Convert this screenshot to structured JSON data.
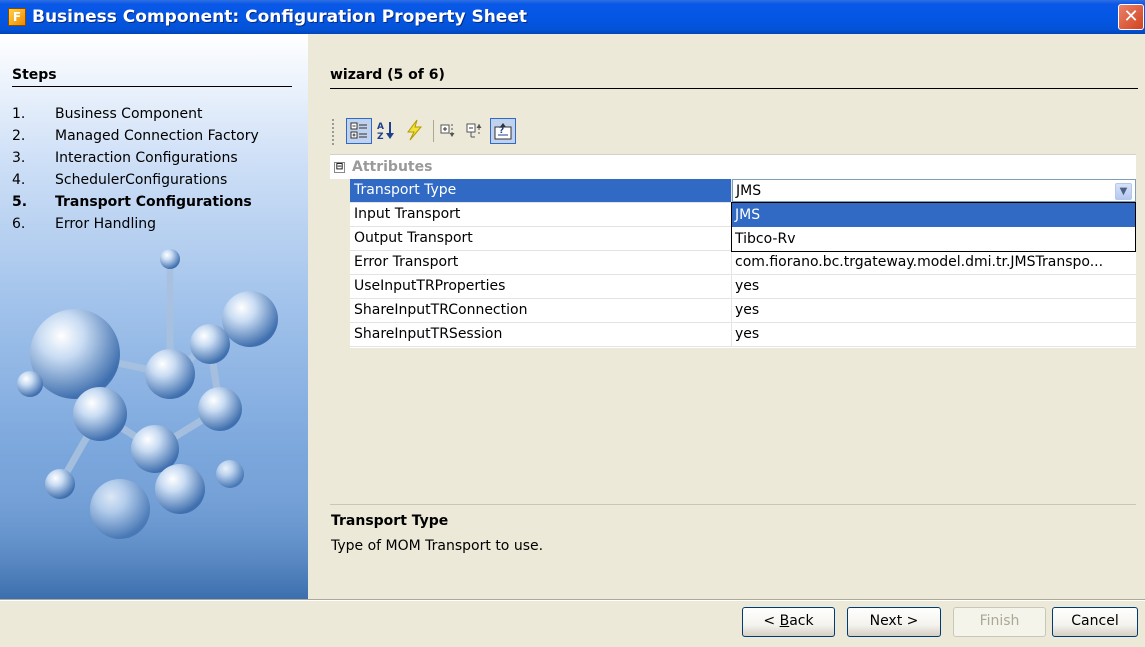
{
  "window": {
    "title": "Business Component: Configuration Property Sheet",
    "close_glyph": "✕"
  },
  "steps": {
    "header": "Steps",
    "items": [
      {
        "num": "1.",
        "label": "Business Component"
      },
      {
        "num": "2.",
        "label": "Managed Connection Factory"
      },
      {
        "num": "3.",
        "label": "Interaction Configurations"
      },
      {
        "num": "4.",
        "label": "SchedulerConfigurations"
      },
      {
        "num": "5.",
        "label": "Transport Configurations",
        "current": true
      },
      {
        "num": "6.",
        "label": "Error Handling"
      }
    ]
  },
  "wizard": {
    "header": "wizard (5 of 6)"
  },
  "toolbar": {
    "buttons": [
      {
        "icon": "categorized-icon",
        "selected": true
      },
      {
        "icon": "sort-alphabetical-icon"
      },
      {
        "icon": "lightning-icon"
      },
      {
        "icon": "expand-all-icon"
      },
      {
        "icon": "collapse-all-icon"
      },
      {
        "icon": "help-description-icon",
        "selected": true
      }
    ]
  },
  "property_sheet": {
    "category": {
      "label": "Attributes",
      "toggle": "⊟"
    },
    "rows": [
      {
        "name": "Transport Type",
        "value": "JMS",
        "selected": true
      },
      {
        "name": "Input Transport",
        "value": ""
      },
      {
        "name": "Output Transport",
        "value": ""
      },
      {
        "name": "Error Transport",
        "value": "com.fiorano.bc.trgateway.model.dmi.tr.JMSTranspo..."
      },
      {
        "name": "UseInputTRProperties",
        "value": "yes"
      },
      {
        "name": "ShareInputTRConnection",
        "value": "yes"
      },
      {
        "name": "ShareInputTRSession",
        "value": "yes"
      }
    ],
    "dropdown_options": [
      "JMS",
      "Tibco-Rv"
    ],
    "dropdown_selected": "JMS"
  },
  "description": {
    "title": "Transport Type",
    "text": "Type of MOM Transport to use."
  },
  "buttons": {
    "back": {
      "label": "< Back",
      "mnemonic": "B"
    },
    "next": "Next >",
    "finish": "Finish",
    "cancel": "Cancel"
  }
}
